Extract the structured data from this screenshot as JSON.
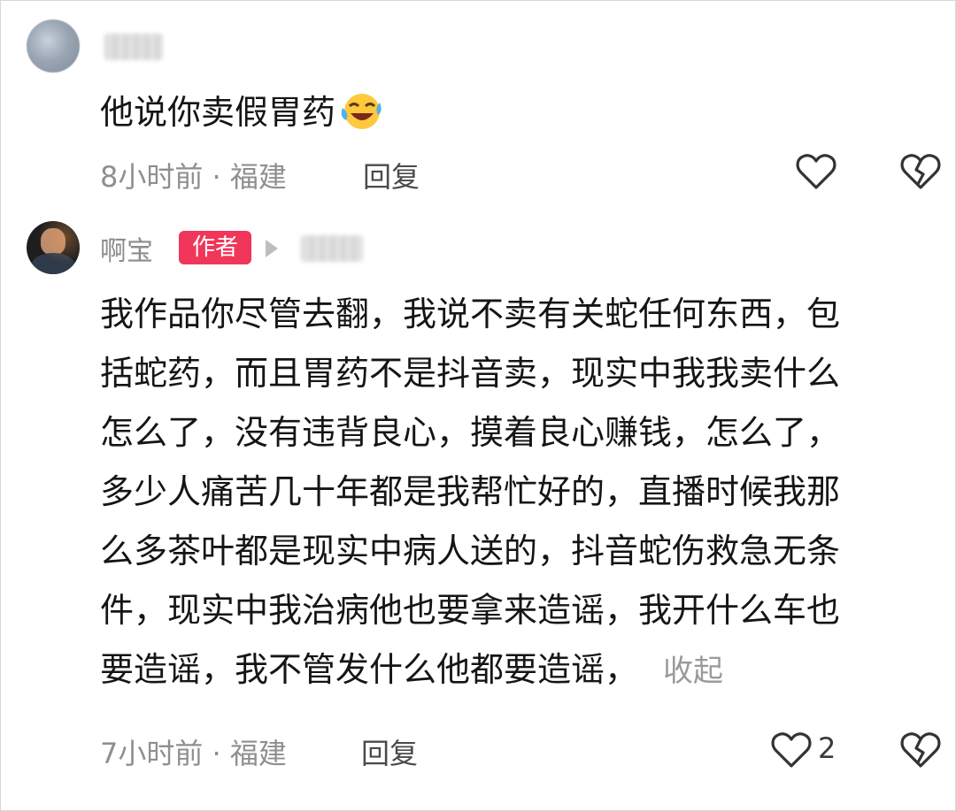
{
  "comments": [
    {
      "username": "",
      "text": "他说你卖假胃药",
      "emoji": "rolling-laughing-emoji",
      "time": "8小时前",
      "location": "福建",
      "reply_label": "回复"
    },
    {
      "username": "啊宝",
      "author_badge": "作者",
      "reply_to": "",
      "text_lines": [
        "我作品你尽管去翻，我说不卖有关蛇任何东西，包",
        "括蛇药，而且胃药不是抖音卖，现实中我我卖什么",
        "怎么了，没有违背良心，摸着良心赚钱，怎么了，",
        "多少人痛苦几十年都是我帮忙好的，直播时候我那",
        "么多茶叶都是现实中病人送的，抖音蛇伤救急无条",
        "件，现实中我治病他也要拿来造谣，我开什么车也",
        "要造谣，我不管发什么他都要造谣，"
      ],
      "collapse_label": "收起",
      "time": "7小时前",
      "location": "福建",
      "reply_label": "回复",
      "like_count": "2"
    }
  ],
  "meta_separator": " · ",
  "icons": {
    "like": "heart-outline-icon",
    "dislike": "broken-heart-icon",
    "author_reply": "play-triangle-icon"
  },
  "colors": {
    "author_badge": "#f0365a",
    "meta_text": "#8f8f8f"
  }
}
